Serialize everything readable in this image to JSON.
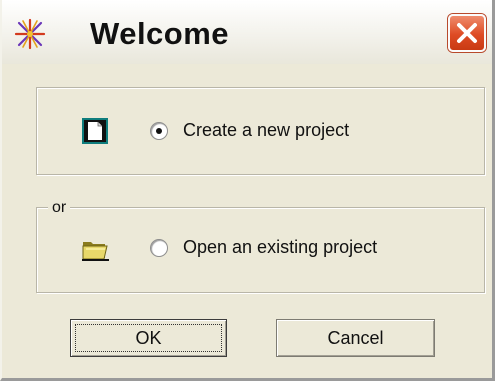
{
  "window": {
    "title": "Welcome",
    "app_icon": "star-burst-icon",
    "close_icon": "close-icon"
  },
  "options": {
    "group_separator_label": "or",
    "create_new_label": "Create a new project",
    "create_new_icon": "new-document-icon",
    "create_new_selected": true,
    "open_existing_label": "Open an existing project",
    "open_existing_icon": "open-folder-icon",
    "open_existing_selected": false
  },
  "buttons": {
    "ok_label": "OK",
    "cancel_label": "Cancel"
  },
  "colors": {
    "dialog_background": "#ece9d8",
    "close_button": "#de4b24"
  }
}
